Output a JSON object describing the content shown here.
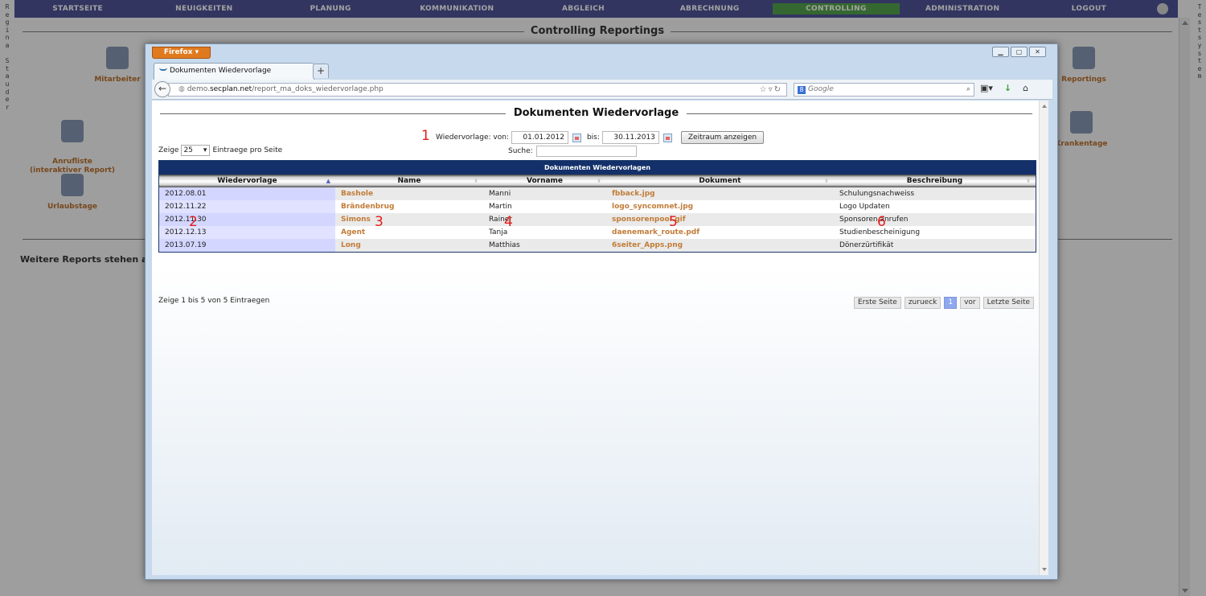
{
  "app": {
    "nav": [
      "STARTSEITE",
      "NEUIGKEITEN",
      "PLANUNG",
      "KOMMUNIKATION",
      "ABGLEICH",
      "ABRECHNUNG",
      "CONTROLLING",
      "ADMINISTRATION",
      "LOGOUT"
    ],
    "active_nav": "CONTROLLING",
    "left_vertical": "R\ne\ng\ni\nn\na\n \nS\nt\na\nu\nd\ne\nr",
    "right_vertical": "T\ne\ns\nt\ns\ny\ns\nt\ne\nm",
    "heading": "Controlling Reportings",
    "tiles": {
      "mitarbeiter": "Mitarbeiter",
      "reportings": "Reportings",
      "anrufliste": "Anrufliste\n(interaktiver Report)",
      "krankentage": "Krankentage",
      "urlaubstage": "Urlaubstage"
    },
    "further": "Weitere Reports stehen auf"
  },
  "browser": {
    "menu_label": "Firefox ▾",
    "tab_title": "Dokumenten Wiedervorlage",
    "new_tab": "+",
    "url_prefix": "demo.",
    "url_host": "secplan.net",
    "url_path": "/report_ma_doks_wiedervorlage.php",
    "search_placeholder": "Google",
    "colors": {
      "menu": "#e07a1f",
      "chrome": "#c7d9ec"
    }
  },
  "page": {
    "title": "Dokumenten Wiedervorlage",
    "annotations": [
      "1",
      "2",
      "3",
      "4",
      "5",
      "6"
    ],
    "filter": {
      "label": "Wiedervorlage: von:",
      "from": "01.01.2012",
      "to_label": "bis:",
      "to": "30.11.2013",
      "button": "Zeitraum anzeigen"
    },
    "length": {
      "prefix": "Zeige",
      "value": "25",
      "suffix": "Eintraege pro Seite"
    },
    "search_label": "Suche:",
    "table": {
      "caption": "Dokumenten Wiedervorlagen",
      "columns": [
        "Wiedervorlage",
        "Name",
        "Vorname",
        "Dokument",
        "Beschreibung"
      ],
      "rows": [
        [
          "2012.08.01",
          "Bashole",
          "Manni",
          "fbback.jpg",
          "Schulungsnachweiss"
        ],
        [
          "2012.11.22",
          "Brändenbrug",
          "Martin",
          "logo_syncomnet.jpg",
          "Logo Updaten"
        ],
        [
          "2012.11.30",
          "Simons",
          "Rainer",
          "sponsorenpool.gif",
          "Sponsoren anrufen"
        ],
        [
          "2012.12.13",
          "Agent",
          "Tanja",
          "daenemark_route.pdf",
          "Studienbescheinigung"
        ],
        [
          "2013.07.19",
          "Long",
          "Matthias",
          "6seiter_Apps.png",
          "Dönerzürtifikät"
        ]
      ]
    },
    "info": "Zeige 1 bis 5 von 5 Eintraegen",
    "pager": {
      "first": "Erste Seite",
      "prev": "zurueck",
      "current": "1",
      "next": "vor",
      "last": "Letzte Seite"
    }
  }
}
